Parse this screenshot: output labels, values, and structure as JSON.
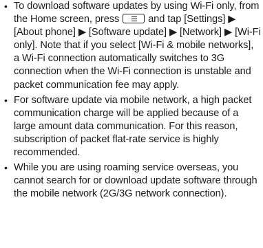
{
  "notes": [
    {
      "parts": [
        "To download software updates by using Wi-Fi only, from the Home screen, press ",
        " and tap [Settings] ▶ [About phone] ▶ [Software update] ▶ [Network] ▶ [Wi-Fi only]. Note that if you select [Wi-Fi & mobile networks], a Wi-Fi connection automatically switches to 3G connection when the Wi-Fi connection is unstable and packet communication fee may apply."
      ],
      "key_icon": "menu-key-icon"
    },
    {
      "text": "For software update via mobile network, a high packet communication charge will be applied because of a large amount data communication. For this reason, subscription of packet flat-rate service is highly recommended."
    },
    {
      "text": "While you are using roaming service overseas, you cannot search for or download update software through the mobile network (2G/3G network connection)."
    }
  ],
  "bullet_glyph": "•"
}
